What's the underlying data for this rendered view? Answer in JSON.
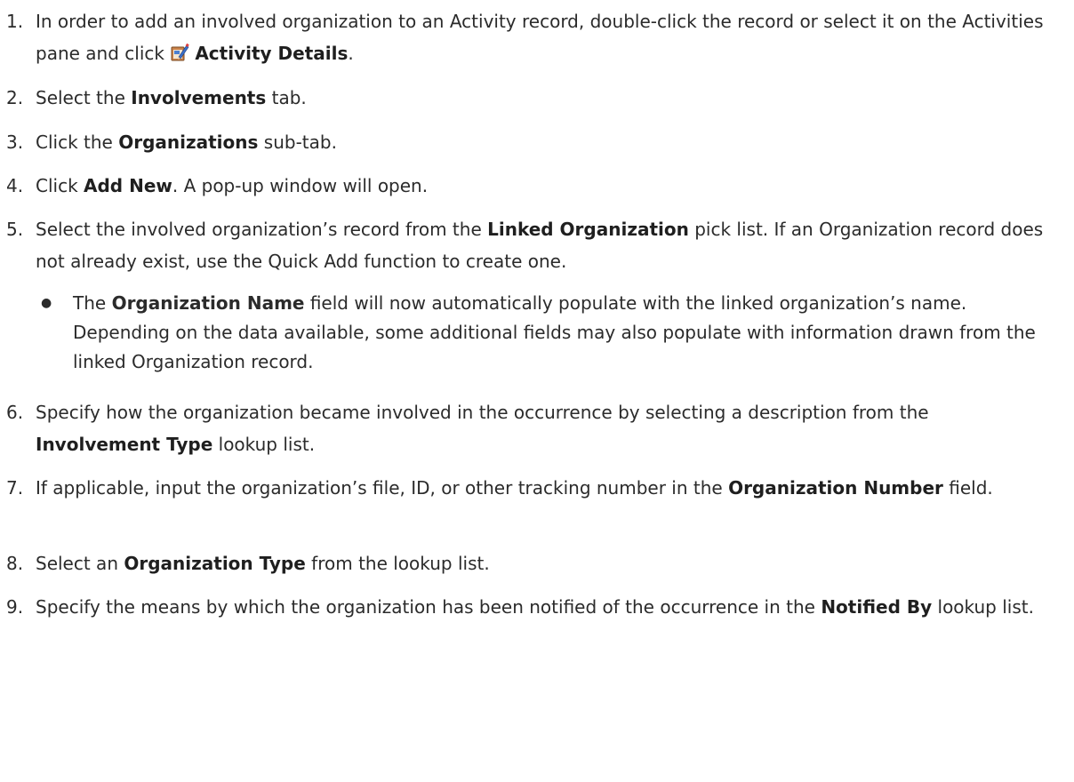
{
  "steps": [
    {
      "num": "1.",
      "parts": [
        {
          "t": "In order to add an involved organization to an Activity record, double-click the record or select it on the Activities pane and click "
        },
        {
          "icon": "activity-details-icon"
        },
        {
          "t": "Activity Details",
          "b": true
        },
        {
          "t": "."
        }
      ]
    },
    {
      "num": "2.",
      "parts": [
        {
          "t": "Select the "
        },
        {
          "t": "Involvements",
          "b": true
        },
        {
          "t": " tab."
        }
      ]
    },
    {
      "num": "3.",
      "parts": [
        {
          "t": "Click the "
        },
        {
          "t": "Organizations",
          "b": true
        },
        {
          "t": " sub-tab."
        }
      ]
    },
    {
      "num": "4.",
      "parts": [
        {
          "t": "Click "
        },
        {
          "t": "Add New",
          "b": true
        },
        {
          "t": ". A pop-up window will open."
        }
      ]
    },
    {
      "num": "5.",
      "parts": [
        {
          "t": "Select the involved organization’s record from the "
        },
        {
          "t": "Linked Organization",
          "b": true
        },
        {
          "t": " pick list. If an Organization record does not already exist, use the Quick Add function to create one."
        }
      ],
      "bullets": [
        {
          "parts": [
            {
              "t": "The "
            },
            {
              "t": "Organization Name",
              "b": true
            },
            {
              "t": " field will now automatically populate with the linked organization’s name. Depending on the data available, some additional fields may also populate with information drawn from the linked Organization record."
            }
          ]
        }
      ]
    },
    {
      "num": "6.",
      "parts": [
        {
          "t": "Specify how the organization became involved in the occurrence by selecting a description from the "
        },
        {
          "t": "Involvement Type",
          "b": true
        },
        {
          "t": " lookup list."
        }
      ]
    },
    {
      "num": "7.",
      "parts": [
        {
          "t": "If applicable, input the organization’s file, ID, or other tracking number in the "
        },
        {
          "t": "Organization Number",
          "b": true
        },
        {
          "t": " field."
        }
      ]
    },
    {
      "num": "8.",
      "parts": [
        {
          "t": "Select an "
        },
        {
          "t": "Organization Type",
          "b": true
        },
        {
          "t": " from the lookup list."
        }
      ]
    },
    {
      "num": "9.",
      "parts": [
        {
          "t": "Specify the means by which the organization has been notified of the occurrence in the "
        },
        {
          "t": "Notified By",
          "b": true
        },
        {
          "t": " lookup list."
        }
      ]
    }
  ]
}
